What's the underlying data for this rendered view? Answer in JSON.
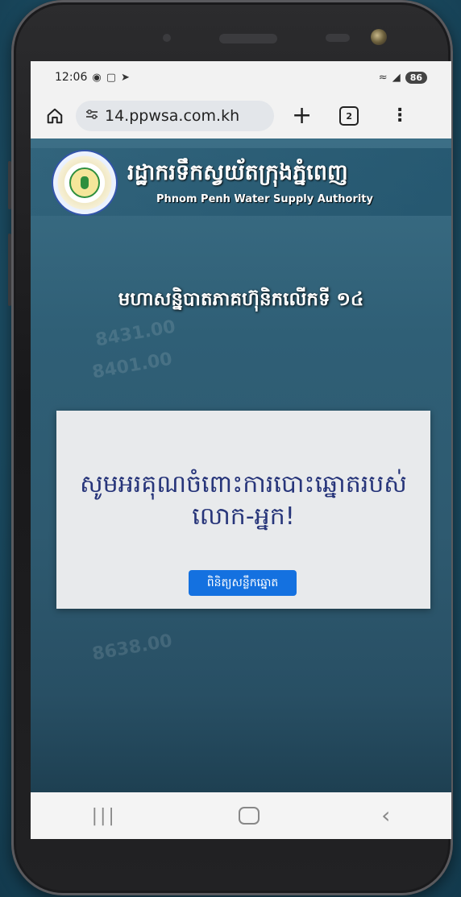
{
  "status": {
    "time": "12:06",
    "battery": "86"
  },
  "browser": {
    "url": "14.ppwsa.com.kh",
    "tab_count": "2"
  },
  "site": {
    "org_name_km": "រដ្ឋាករទឹកស្វយ័តក្រុងភ្នំពេញ",
    "org_name_en": "Phnom Penh Water Supply Authority",
    "page_title": "មហាសន្និបាតភាគហ៊ុនិកលើកទី ១៤",
    "message": "សូមអរគុណចំពោះការបោះឆ្នោតរបស់ លោក-អ្នក!",
    "button_label": "ពិនិត្យសន្លឹកឆ្នោត",
    "deco_numbers": [
      "8431.00",
      "8401.00",
      "8638.00"
    ]
  },
  "colors": {
    "accent_button": "#1471e0",
    "message_text": "#27357a",
    "page_bg": "#2f5f76"
  },
  "icons": {
    "home": "home-icon",
    "tune": "site-info-icon",
    "plus": "new-tab-icon",
    "tabs": "tab-switcher-icon",
    "menu": "more-vert-icon"
  }
}
